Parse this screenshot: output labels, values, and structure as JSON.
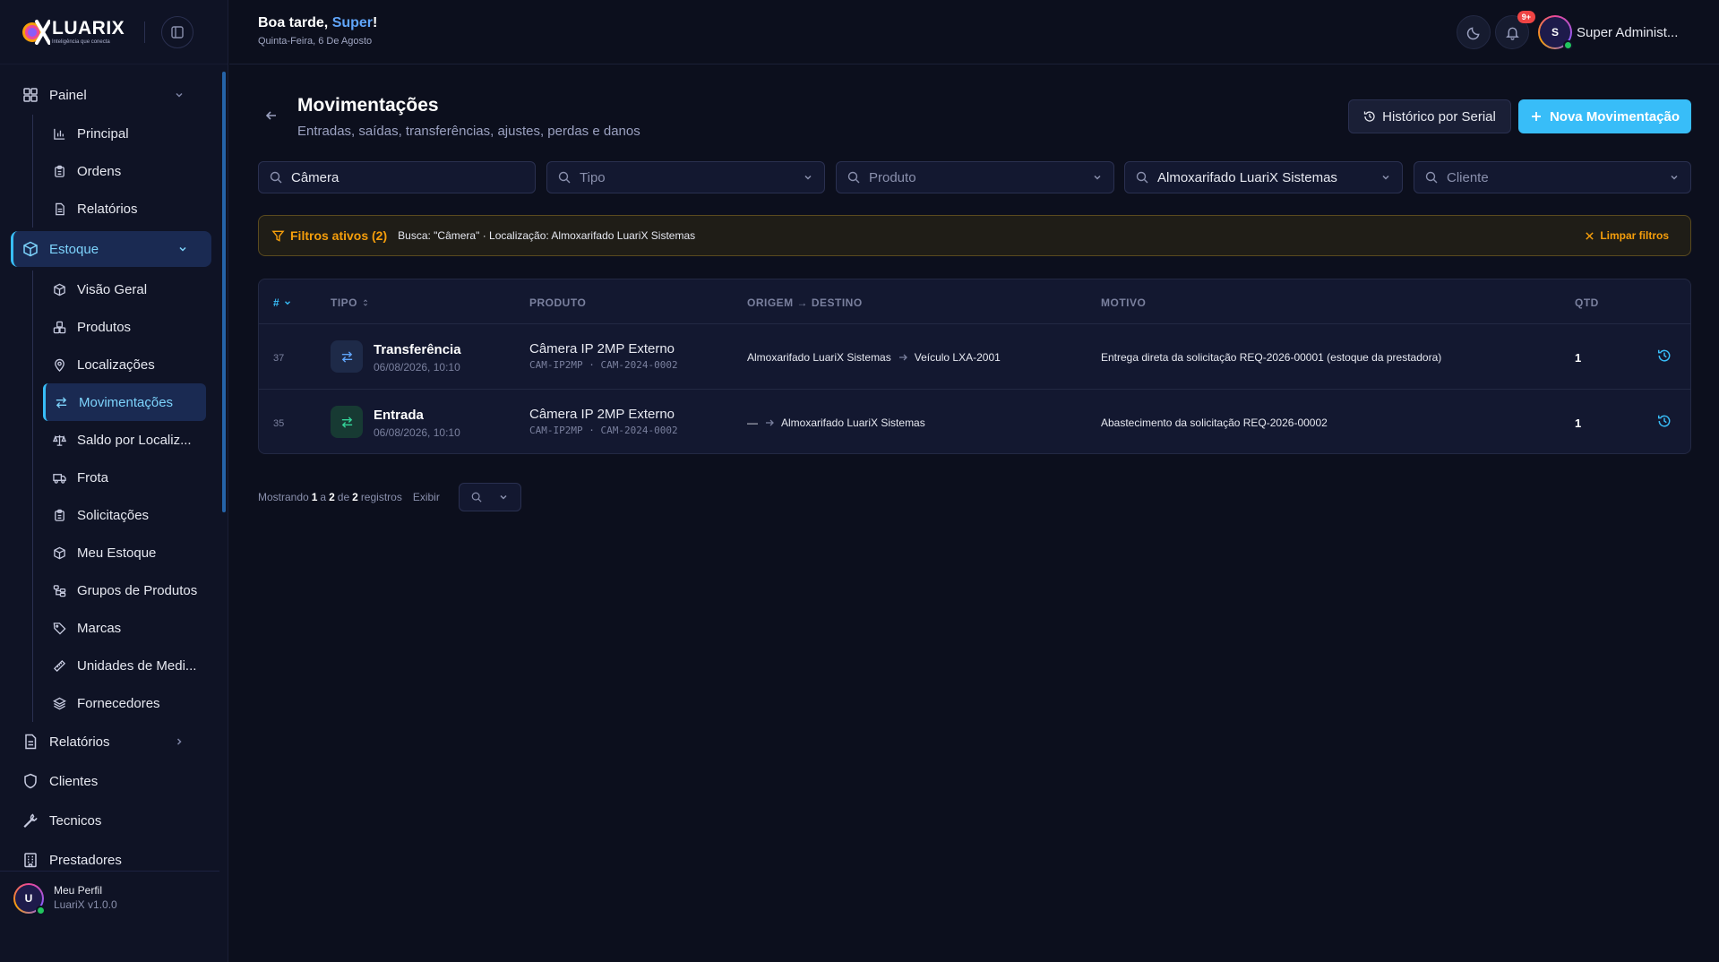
{
  "brand": {
    "name": "LUARIX",
    "tagline": "Inteligência que conecta"
  },
  "header": {
    "greeting_prefix": "Boa tarde, ",
    "greeting_name": "Super",
    "greeting_suffix": "!",
    "date": "Quinta-Feira, 6 De Agosto",
    "notifications_badge": "9+",
    "user_initial": "S",
    "user_name": "Super Administ..."
  },
  "sidebar": {
    "painel": "Painel",
    "painel_items": [
      "Principal",
      "Ordens",
      "Relatórios"
    ],
    "estoque": "Estoque",
    "estoque_items": [
      "Visão Geral",
      "Produtos",
      "Localizações",
      "Movimentações",
      "Saldo por Localiz...",
      "Frota",
      "Solicitações",
      "Meu Estoque",
      "Grupos de Produtos",
      "Marcas",
      "Unidades de Medi...",
      "Fornecedores"
    ],
    "relatorios": "Relatórios",
    "clientes": "Clientes",
    "tecnicos": "Tecnicos",
    "prestadores": "Prestadores",
    "profile_initial": "U",
    "profile_name": "Meu Perfil",
    "profile_version": "LuariX v1.0.0"
  },
  "page": {
    "title": "Movimentações",
    "subtitle": "Entradas, saídas, transferências, ajustes, perdas e danos",
    "history_button": "Histórico por Serial",
    "new_button": "Nova Movimentação"
  },
  "filters": {
    "search_value": "Câmera",
    "tipo_placeholder": "Tipo",
    "produto_placeholder": "Produto",
    "local_value": "Almoxarifado LuariX Sistemas",
    "cliente_placeholder": "Cliente"
  },
  "active_filters": {
    "label": "Filtros ativos (2)",
    "description": "Busca: \"Câmera\" · Localização: Almoxarifado LuariX Sistemas",
    "clear": "Limpar filtros"
  },
  "table": {
    "columns": [
      "#",
      "TIPO",
      "PRODUTO",
      "ORIGEM → DESTINO",
      "MOTIVO",
      "QTD"
    ],
    "rows": [
      {
        "id": "37",
        "type": "Transferência",
        "date": "06/08/2026, 10:10",
        "product": "Câmera IP 2MP Externo",
        "code": "CAM-IP2MP · CAM-2024-0002",
        "origin": "Almoxarifado LuariX Sistemas",
        "destination": "Veículo LXA-2001",
        "reason": "Entrega direta da solicitação REQ-2026-00001 (estoque da prestadora)",
        "qty": "1",
        "color": "#60a5fa",
        "bg": "#1e2a48"
      },
      {
        "id": "35",
        "type": "Entrada",
        "date": "06/08/2026, 10:10",
        "product": "Câmera IP 2MP Externo",
        "code": "CAM-IP2MP · CAM-2024-0002",
        "origin": "—",
        "destination": "Almoxarifado LuariX Sistemas",
        "reason": "Abastecimento da solicitação REQ-2026-00002",
        "qty": "1",
        "color": "#34d399",
        "bg": "#173a33"
      }
    ]
  },
  "pager": {
    "showing": "Mostrando",
    "from": "1",
    "a": "a",
    "to": "2",
    "de": "de",
    "total": "2",
    "registros": "registros",
    "exibir": "Exibir"
  }
}
